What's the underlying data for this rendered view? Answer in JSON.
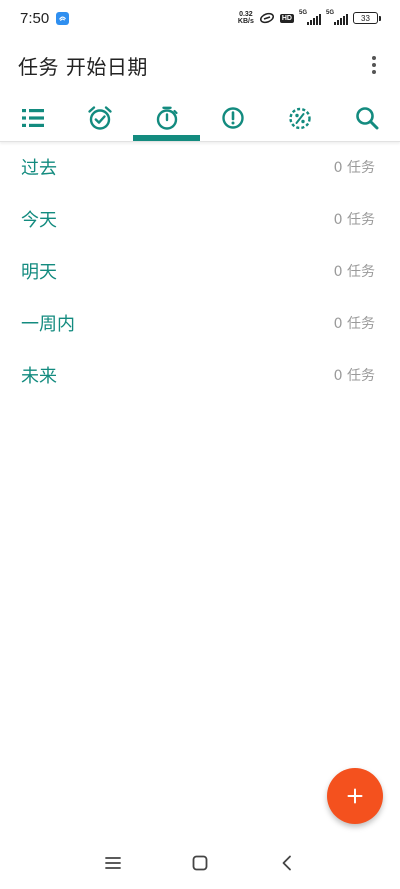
{
  "status_bar": {
    "time": "7:50",
    "net_speed_value": "0.32",
    "net_speed_unit": "KB/s",
    "hd_label": "HD",
    "signal1_label": "5G",
    "signal2_label": "5G",
    "battery_level": "33"
  },
  "app_bar": {
    "title": "任务 开始日期"
  },
  "tabs": [
    {
      "icon": "list-icon",
      "active": false
    },
    {
      "icon": "alarm-check-icon",
      "active": false
    },
    {
      "icon": "timer-icon",
      "active": true
    },
    {
      "icon": "alert-circle-icon",
      "active": false
    },
    {
      "icon": "percent-progress-icon",
      "active": false
    },
    {
      "icon": "search-icon",
      "active": false
    }
  ],
  "list": {
    "items": [
      {
        "label": "过去",
        "count": "0 任务"
      },
      {
        "label": "今天",
        "count": "0 任务"
      },
      {
        "label": "明天",
        "count": "0 任务"
      },
      {
        "label": "一周内",
        "count": "0 任务"
      },
      {
        "label": "未来",
        "count": "0 任务"
      }
    ]
  },
  "colors": {
    "accent": "#138b7f",
    "fab": "#f4511e",
    "count_text": "#9a9a9a"
  }
}
